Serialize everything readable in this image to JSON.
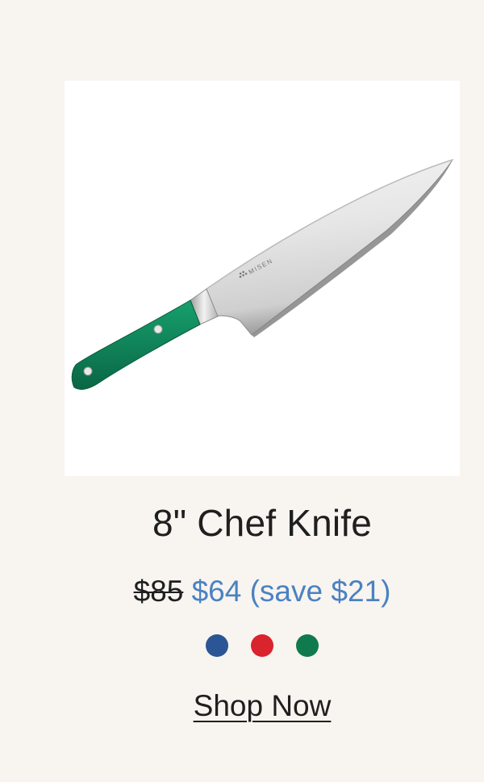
{
  "product": {
    "title": "8\" Chef Knife",
    "brand_mark": "MISEN",
    "price_original": "$85",
    "price_sale": "$64 (save $21)",
    "swatches": [
      {
        "name": "blue",
        "color": "#2b5595"
      },
      {
        "name": "red",
        "color": "#d9232d"
      },
      {
        "name": "green",
        "color": "#0f7a4d"
      }
    ],
    "cta_label": "Shop Now"
  },
  "colors": {
    "background": "#f8f4f0",
    "accent_price": "#4a82c2",
    "handle_green": "#108359",
    "text": "#1f1f1f"
  }
}
